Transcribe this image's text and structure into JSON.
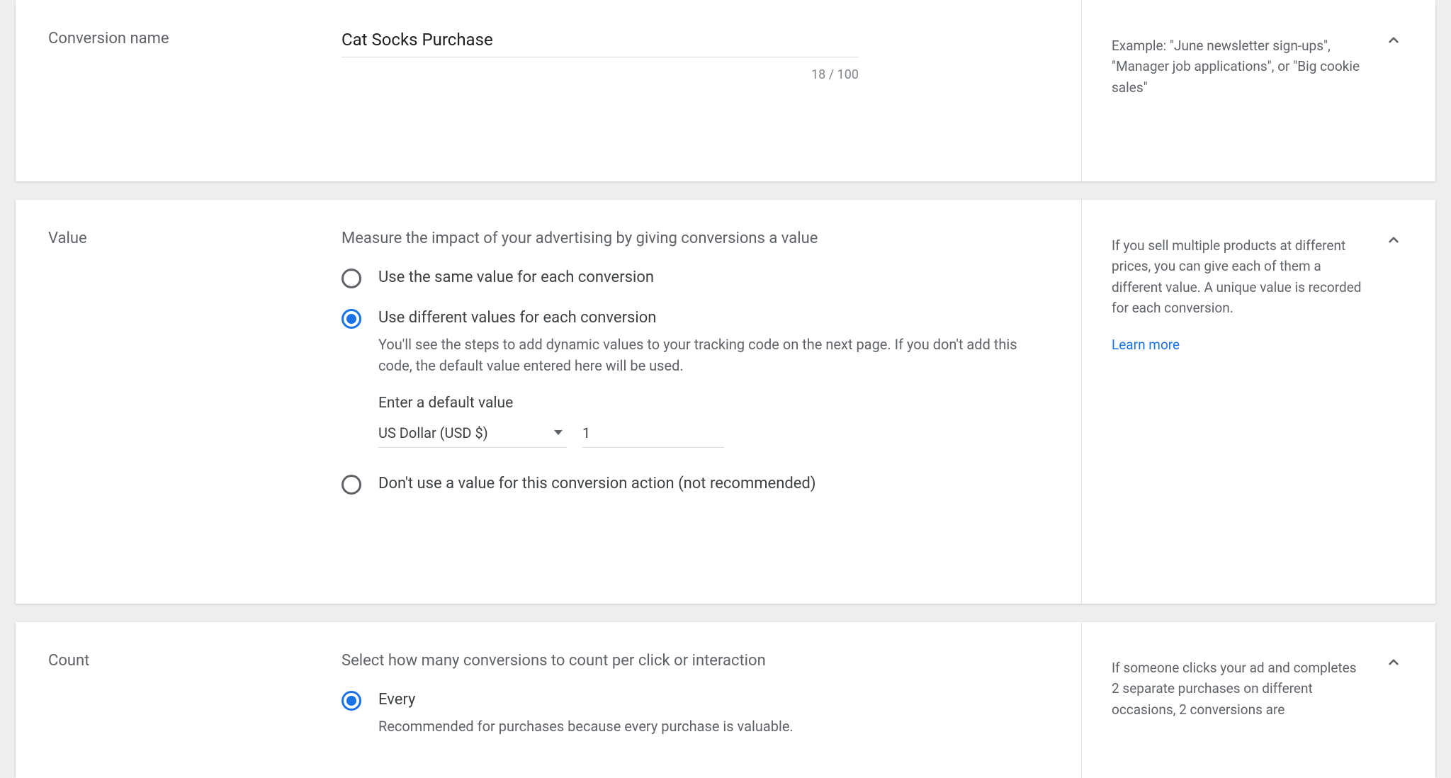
{
  "name_section": {
    "label": "Conversion name",
    "value": "Cat Socks Purchase",
    "char_count": "18 / 100",
    "help": "Example: \"June newsletter sign-ups\", \"Manager job applications\", or \"Big cookie sales\""
  },
  "value_section": {
    "label": "Value",
    "description": "Measure the impact of your advertising by giving conversions a value",
    "options": {
      "same": "Use the same value for each conversion",
      "different": {
        "label": "Use different values for each conversion",
        "sub": "You'll see the steps to add dynamic values to your tracking code on the next page. If you don't add this code, the default value entered here will be used.",
        "default_label": "Enter a default value",
        "currency": "US Dollar (USD $)",
        "amount": "1"
      },
      "none": "Don't use a value for this conversion action (not recommended)"
    },
    "help": "If you sell multiple products at different prices, you can give each of them a different value. A unique value is recorded for each conversion.",
    "learn_more": "Learn more"
  },
  "count_section": {
    "label": "Count",
    "description": "Select how many conversions to count per click or interaction",
    "options": {
      "every": {
        "label": "Every",
        "sub": "Recommended for purchases because every purchase is valuable."
      }
    },
    "help": "If someone clicks your ad and completes 2 separate purchases on different occasions, 2 conversions are"
  }
}
